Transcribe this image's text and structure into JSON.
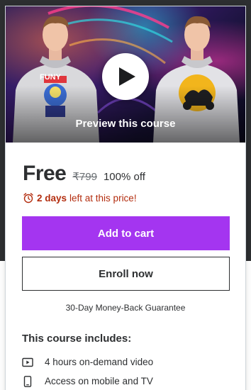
{
  "preview": {
    "label": "Preview this course",
    "graphics_text": "FUNY"
  },
  "pricing": {
    "current_price": "Free",
    "original_price": "₹799",
    "discount": "100% off",
    "timer_bold": "2 days",
    "timer_rest": "left at this price!"
  },
  "actions": {
    "add_to_cart": "Add to cart",
    "enroll_now": "Enroll now"
  },
  "guarantee": "30-Day Money-Back Guarantee",
  "includes": {
    "title": "This course includes:",
    "items": [
      {
        "icon": "video-icon",
        "label": "4 hours on-demand video"
      },
      {
        "icon": "mobile-icon",
        "label": "Access on mobile and TV"
      }
    ]
  },
  "colors": {
    "accent": "#a435f0",
    "timer": "#b32d0f",
    "text": "#2d2f31",
    "header_band": "#2d2f31"
  }
}
